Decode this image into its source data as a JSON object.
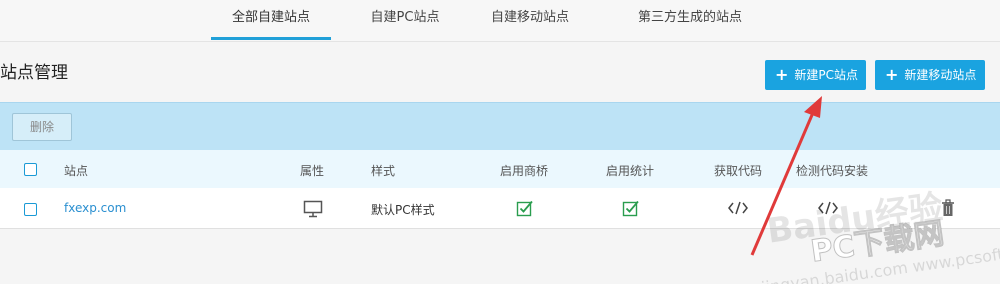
{
  "tabs": [
    {
      "label": "全部自建站点",
      "active": true
    },
    {
      "label": "自建PC站点",
      "active": false
    },
    {
      "label": "自建移动站点",
      "active": false
    },
    {
      "label": "第三方生成的站点",
      "active": false
    }
  ],
  "page_title": "站点管理",
  "buttons": {
    "new_pc": "新建PC站点",
    "new_mobile": "新建移动站点",
    "delete": "删除"
  },
  "table": {
    "headers": {
      "site": "站点",
      "attr": "属性",
      "style": "样式",
      "shangqiao": "启用商桥",
      "stats": "启用统计",
      "get_code": "获取代码",
      "check_code": "检测代码安装"
    },
    "rows": [
      {
        "site": "fxexp.com",
        "attr_icon": "monitor-icon",
        "style": "默认PC样式",
        "shangqiao": true,
        "stats": true,
        "code_icon": "code-icon",
        "check_icon": "code-icon",
        "delete_icon": "trash-icon"
      }
    ]
  },
  "watermark": {
    "brand_text": "Baidu经验",
    "site_name": "PC下载网",
    "url": "jingyan.baidu.com www.pcsoft.com.cn"
  },
  "colors": {
    "accent": "#1aa3e0",
    "toolbar": "#bde3f6",
    "table_header": "#ebf8fe",
    "check_green": "#2a9d4e",
    "arrow_red": "#e03a3a"
  }
}
